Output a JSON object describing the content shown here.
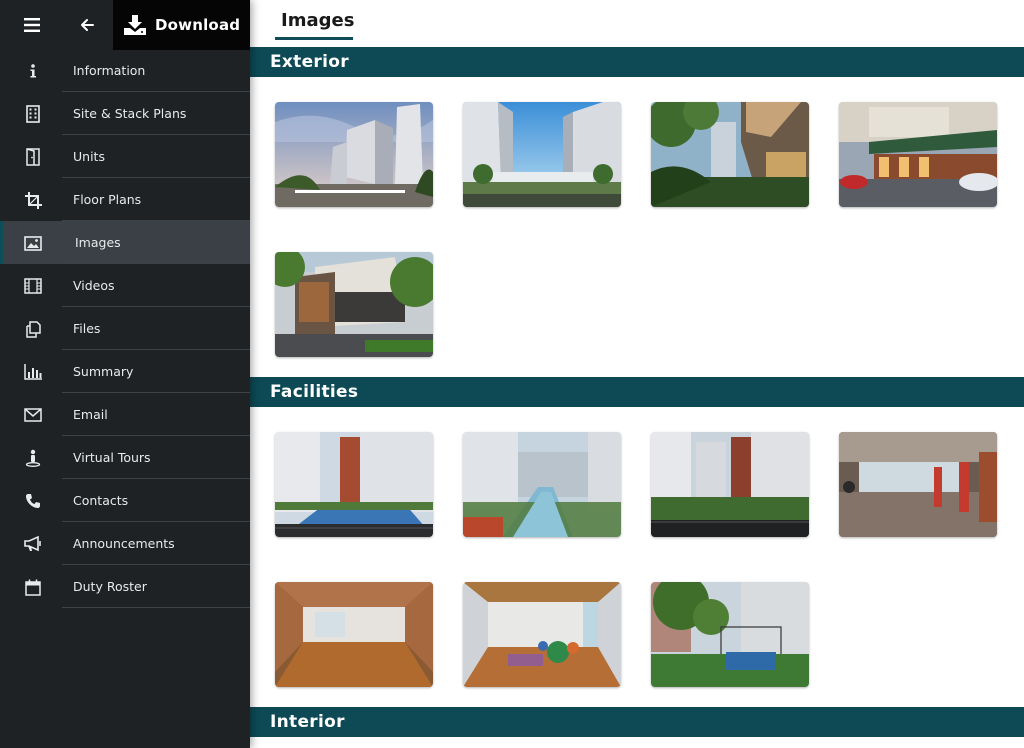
{
  "header": {
    "download_label": "Download"
  },
  "icons": {
    "menu": "hamburger-icon",
    "back": "arrow-left-icon",
    "download": "download-icon"
  },
  "sidebar": {
    "items": [
      {
        "label": "Information",
        "icon": "info-icon"
      },
      {
        "label": "Site & Stack Plans",
        "icon": "building-icon"
      },
      {
        "label": "Units",
        "icon": "door-icon"
      },
      {
        "label": "Floor Plans",
        "icon": "crop-icon"
      },
      {
        "label": "Images",
        "icon": "image-icon",
        "active": true
      },
      {
        "label": "Videos",
        "icon": "film-icon"
      },
      {
        "label": "Files",
        "icon": "files-icon"
      },
      {
        "label": "Summary",
        "icon": "bar-chart-icon"
      },
      {
        "label": "Email",
        "icon": "envelope-icon"
      },
      {
        "label": "Virtual Tours",
        "icon": "person-pin-icon"
      },
      {
        "label": "Contacts",
        "icon": "phone-icon"
      },
      {
        "label": "Announcements",
        "icon": "megaphone-icon"
      },
      {
        "label": "Duty Roster",
        "icon": "calendar-icon"
      }
    ]
  },
  "main": {
    "title": "Images",
    "sections": [
      {
        "name": "Exterior",
        "image_count": 5
      },
      {
        "name": "Facilities",
        "image_count": 7
      },
      {
        "name": "Interior"
      }
    ]
  },
  "colors": {
    "sidebar_bg": "#1f2225",
    "sidebar_active_bg": "#3a4045",
    "section_header_bg": "#0d4a55",
    "title_underline": "#0f4c57"
  }
}
